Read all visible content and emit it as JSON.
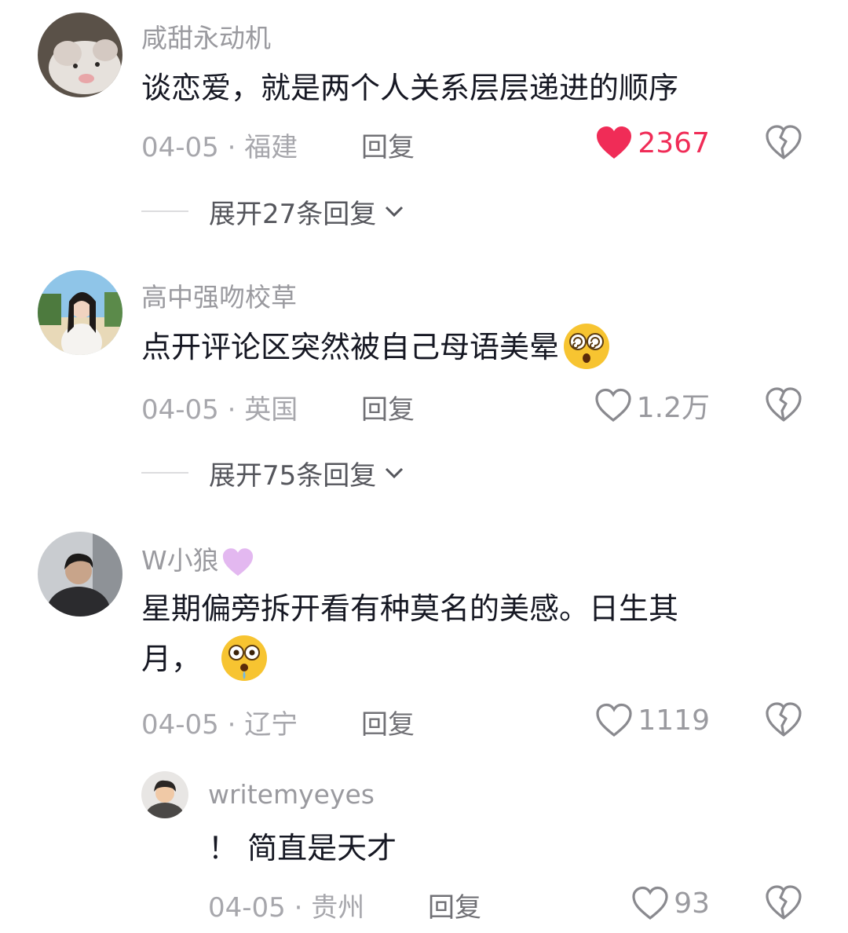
{
  "comments": [
    {
      "username": "咸甜永动机",
      "text": "谈恋爱，就是两个人关系层层递进的顺序",
      "date": "04-05",
      "location": "福建",
      "reply_label": "回复",
      "likes": "2367",
      "liked": true,
      "expand_label": "展开27条回复"
    },
    {
      "username": "高中强吻校草",
      "text": "点开评论区突然被自己母语美晕",
      "emoji": "dizzy-face-emoji",
      "date": "04-05",
      "location": "英国",
      "reply_label": "回复",
      "likes": "1.2万",
      "liked": false,
      "expand_label": "展开75条回复"
    },
    {
      "username": "W小狼",
      "username_emoji": "purple-heart-emoji",
      "text_line1": "星期偏旁拆开看有种莫名的美感。日生其",
      "text_line2": "月，",
      "emoji": "drooling-face-emoji",
      "date": "04-05",
      "location": "辽宁",
      "reply_label": "回复",
      "likes": "1119",
      "liked": false
    },
    {
      "username": "writemyeyes",
      "text": "！ 简直是天才",
      "date": "04-05",
      "location": "贵州",
      "reply_label": "回复",
      "likes": "93",
      "liked": false,
      "is_reply": true
    }
  ],
  "meta_separator": " · ",
  "colors": {
    "like_active": "#f02c57",
    "meta": "#a7a7ac",
    "username": "#9a9a9f"
  }
}
